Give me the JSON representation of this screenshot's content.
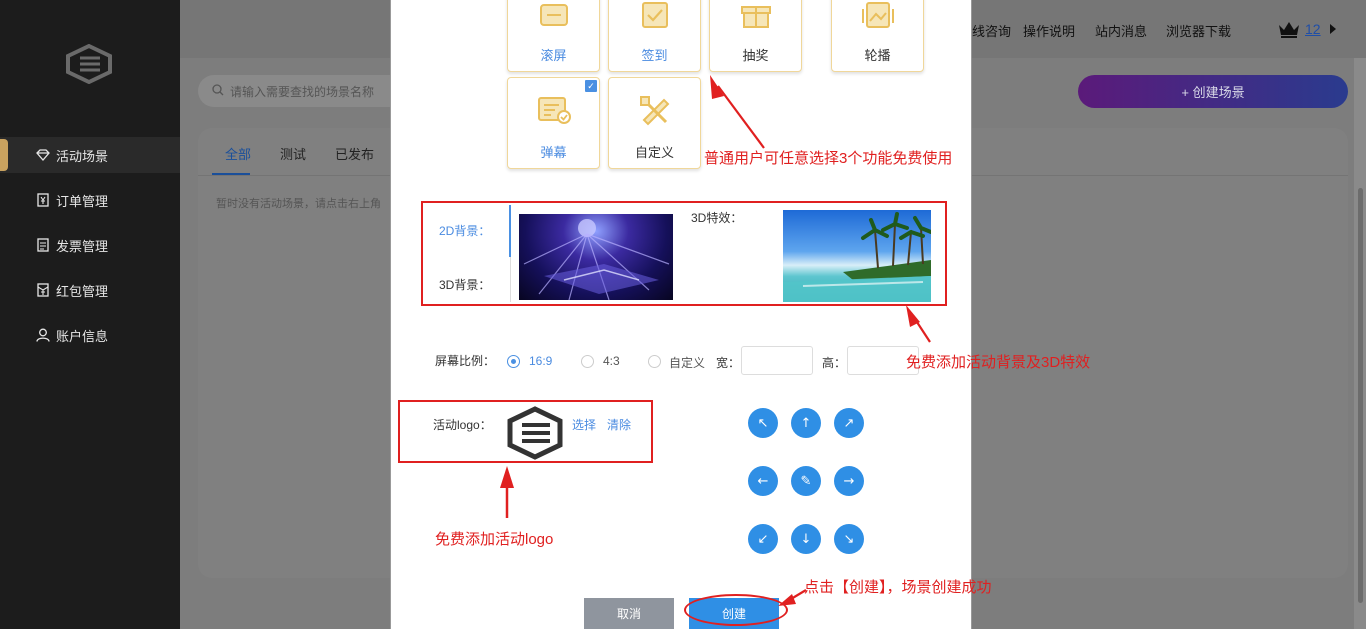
{
  "sidebar": {
    "items": [
      {
        "label": "活动场景",
        "icon": "diamond-icon"
      },
      {
        "label": "订单管理",
        "icon": "order-icon"
      },
      {
        "label": "发票管理",
        "icon": "invoice-icon"
      },
      {
        "label": "红包管理",
        "icon": "red-packet-icon"
      },
      {
        "label": "账户信息",
        "icon": "user-icon"
      }
    ]
  },
  "header": {
    "links": [
      "线咨询",
      "操作说明",
      "站内消息",
      "浏览器下载"
    ],
    "vip_count": "12"
  },
  "search": {
    "placeholder": "请输入需要查找的场景名称"
  },
  "create_scene_label": "+ 创建场景",
  "main": {
    "tabs": [
      "全部",
      "测试",
      "已发布"
    ],
    "empty_hint": "暂时没有活动场景，请点击右上角"
  },
  "modal": {
    "features": [
      {
        "label": "滚屏",
        "icon": "scroll-screen-icon"
      },
      {
        "label": "签到",
        "icon": "sign-in-icon"
      },
      {
        "label": "抽奖",
        "icon": "gift-icon"
      },
      {
        "label": "轮播",
        "icon": "carousel-icon"
      },
      {
        "label": "弹幕",
        "icon": "barrage-icon"
      },
      {
        "label": "自定义",
        "icon": "custom-icon"
      }
    ],
    "bg_2d_label": "2D背景：",
    "bg_3d_label": "3D背景：",
    "effect_3d_label": "3D特效：",
    "ratio_label": "屏幕比例：",
    "ratio_options": [
      "16:9",
      "4:3",
      "自定义"
    ],
    "ratio_selected": "16:9",
    "width_label": "宽：",
    "height_label": "高：",
    "logo_label": "活动logo：",
    "select_label": "选择",
    "clear_label": "清除",
    "cancel_label": "取消",
    "create_label": "创建"
  },
  "annotations": {
    "features_note": "普通用户可任意选择3个功能免费使用",
    "bg_note": "免费添加活动背景及3D特效",
    "logo_note": "免费添加活动logo",
    "create_note": "点击【创建】，场景创建成功"
  },
  "colors": {
    "annotation_red": "#e02020",
    "primary_blue": "#2f8fe5",
    "feature_border": "#f0d79a",
    "create_scene_gradient_start": "#5b1a7a",
    "create_scene_gradient_end": "#2a3b8e"
  }
}
